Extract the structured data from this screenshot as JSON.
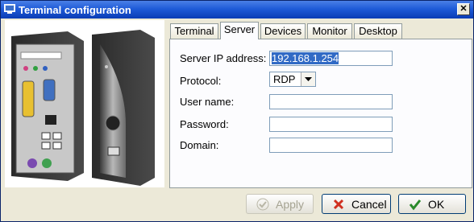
{
  "window": {
    "title": "Terminal configuration",
    "close_glyph": "✕"
  },
  "tabs": [
    {
      "label": "Terminal",
      "active": false
    },
    {
      "label": "Server",
      "active": true
    },
    {
      "label": "Devices",
      "active": false
    },
    {
      "label": "Monitor",
      "active": false
    },
    {
      "label": "Desktop",
      "active": false
    }
  ],
  "form": {
    "server_ip_label": "Server IP address:",
    "server_ip_value": "192.168.1.254",
    "protocol_label": "Protocol:",
    "protocol_value": "RDP",
    "username_label": "User name:",
    "username_value": "",
    "password_label": "Password:",
    "password_value": "",
    "domain_label": "Domain:",
    "domain_value": ""
  },
  "buttons": {
    "apply_label": "Apply",
    "apply_enabled": false,
    "cancel_label": "Cancel",
    "ok_label": "OK"
  },
  "icons": {
    "title": "terminal-window-icon",
    "apply": "check-icon",
    "cancel": "x-icon",
    "ok": "check-icon",
    "dropdown": "chevron-down-icon"
  },
  "colors": {
    "titlebar": "#0a3cb5",
    "selection": "#316ac5",
    "cancel_x": "#d03020",
    "ok_check": "#2a8a2a"
  }
}
